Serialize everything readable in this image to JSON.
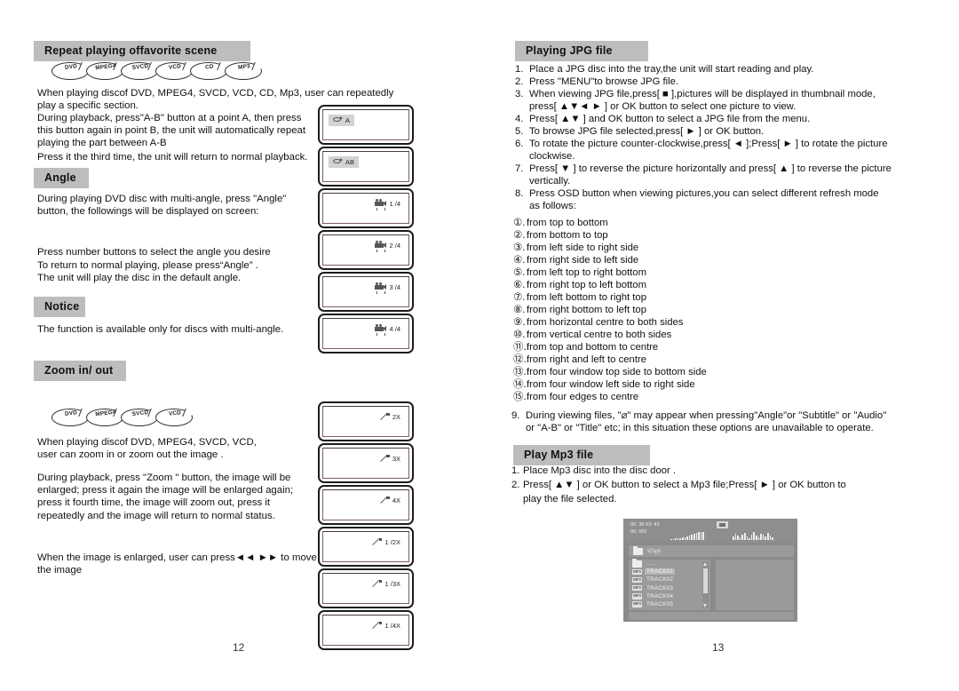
{
  "document": {
    "left_page_number": "12",
    "right_page_number": "13"
  },
  "left_column": {
    "sections": [
      {
        "title": "Repeat playing offavorite scene"
      },
      {
        "title": "Angle"
      },
      {
        "title": "Notice"
      },
      {
        "title": "Zoom in/ out"
      }
    ],
    "repeat": {
      "disc_formats": [
        "DVD",
        "MPEG4",
        "SVCD",
        "VCD",
        "CD",
        "MP3"
      ],
      "para1": "When playing discof DVD, MPEG4, SVCD, VCD, CD, Mp3,  user can repeatedly\nplay a specific section.",
      "para2": "During playback, press\"A-B\" button at a point A, then press\nthis button again in  point B, the unit will automatically repeat\nplaying the part between A-B",
      "para3": "Press it the third time, the unit will return to normal playback.",
      "screens": [
        {
          "icon": "repeat-icon",
          "label": "A"
        },
        {
          "icon": "repeat-icon",
          "label": "AB"
        }
      ]
    },
    "angle": {
      "para1": "During playing DVD disc with multi-angle, press \"Angle\"\n button, the followings will be displayed on screen:",
      "para2": "Press number buttons to select the angle you desire",
      "para3": "To return to normal playing, please press“Angle” .\nThe unit will play the disc in the default angle.",
      "screens": [
        {
          "icon": "camera-icon",
          "label": "1 /4"
        },
        {
          "icon": "camera-icon",
          "label": "2 /4"
        },
        {
          "icon": "camera-icon",
          "label": "3 /4"
        },
        {
          "icon": "camera-icon",
          "label": "4 /4"
        }
      ]
    },
    "notice": {
      "para1": "The function is available only for discs with multi-angle."
    },
    "zoom": {
      "disc_formats": [
        "DVD",
        "MPEG4",
        "SVCD",
        "VCD"
      ],
      "para1": "When playing discof DVD, MPEG4, SVCD, VCD,\nuser can zoom in or zoom out the image .",
      "para2": "During playback, press \"Zoom \" button, the image will be\nenlarged; press it again the image will be enlarged again;\npress it fourth time, the image will zoom out, press it\nrepeatedly and the image will return to normal status.",
      "para3": "When the image is enlarged, user can press◄◄ ►► to move\nthe image",
      "screens": [
        {
          "icon": "zoom-icon",
          "label": "2X"
        },
        {
          "icon": "zoom-icon",
          "label": "3X"
        },
        {
          "icon": "zoom-icon",
          "label": "4X"
        },
        {
          "icon": "zoom-icon",
          "label": "1 /2X"
        },
        {
          "icon": "zoom-icon",
          "label": "1 /3X"
        },
        {
          "icon": "zoom-icon",
          "label": "1 /4X"
        }
      ]
    }
  },
  "right_column": {
    "sections": [
      {
        "title": "Playing JPG file"
      },
      {
        "title": "Play Mp3 file"
      }
    ],
    "jpg_steps": [
      {
        "num": "1.",
        "text": "Place a JPG disc into the tray,the unit will start reading and play."
      },
      {
        "num": "2.",
        "text": "Press \"MENU\"to browse JPG file."
      },
      {
        "num": "3.",
        "text": "When viewing JPG file,press[ ■ ],pictures will be displayed in thumbnail mode,"
      },
      {
        "num": "",
        "text": "press[ ▲▼◄ ► ] or OK button to select one picture to view.",
        "indent": true
      },
      {
        "num": "4.",
        "text": "Press[ ▲▼ ] and OK button to select a JPG file from the menu."
      },
      {
        "num": "5.",
        "text": "To browse JPG file selected,press[ ► ]   or OK button."
      },
      {
        "num": "6.",
        "text": "To rotate the picture counter-clockwise,press[ ◄  ];Press[ ► ] to rotate the picture"
      },
      {
        "num": "",
        "text": "clockwise.",
        "indent": true
      },
      {
        "num": "7.",
        "text": "Press[ ▼ ]  to reverse the picture horizontally and press[ ▲ ]  to reverse the picture"
      },
      {
        "num": "",
        "text": "vertically.",
        "indent": true
      },
      {
        "num": "8.",
        "text": "Press OSD button when viewing pictures,you can select different refresh mode"
      },
      {
        "num": "",
        "text": "as follows:",
        "indent": true
      }
    ],
    "refresh_modes": [
      {
        "num": "①.",
        "text": "from top to bottom"
      },
      {
        "num": "②.",
        "text": "from bottom to top"
      },
      {
        "num": "③.",
        "text": "from left side to right side"
      },
      {
        "num": "④.",
        "text": "from right side to left side"
      },
      {
        "num": "⑤.",
        "text": "from left top to right bottom"
      },
      {
        "num": "⑥.",
        "text": "from right top to left bottom"
      },
      {
        "num": "⑦.",
        "text": "from left bottom to right top"
      },
      {
        "num": "⑧.",
        "text": "from right bottom to left top"
      },
      {
        "num": "⑨.",
        "text": "from horizontal centre to both sides"
      },
      {
        "num": "⑩.",
        "text": "from vertical centre to both sides"
      },
      {
        "num": "⑪.",
        "text": "from top and bottom to centre"
      },
      {
        "num": "⑫.",
        "text": "from right and left to centre"
      },
      {
        "num": "⑬.",
        "text": "from four window top side to bottom side"
      },
      {
        "num": "⑭.",
        "text": "from four window left side to right side"
      },
      {
        "num": "⑮.",
        "text": "from four edges to centre"
      }
    ],
    "jpg_note": [
      {
        "num": "9.",
        "text": "During viewing files, \"⌀\" may appear when pressing\"Angle\"or \"Subtitle\" or \"Audio\""
      },
      {
        "num": "",
        "text": "or \"A-B\" or \"Title\" etc; in this situation these options are unavailable to operate.",
        "indent": true
      }
    ],
    "mp3_steps": [
      {
        "num": "1.",
        "text": "Place Mp3 disc into the disc door ."
      },
      {
        "num": "2.",
        "text": "Press[ ▲▼ ]  or  OK button to select a Mp3 file;Press[ ► ]  or  OK  button to"
      },
      {
        "num": "",
        "text": "play the file selected.",
        "indent": true
      }
    ],
    "mp3_screen": {
      "time_display": "00: 36 03: 43\n00: 001",
      "path": "\\C\\yy\\",
      "up_entry": "......",
      "tracks": [
        {
          "badge": "MP3",
          "name": "TRACK01",
          "selected": true
        },
        {
          "badge": "MP3",
          "name": "TRACK02",
          "selected": false
        },
        {
          "badge": "MP3",
          "name": "TRACK03",
          "selected": false
        },
        {
          "badge": "MP3",
          "name": "TRACK04",
          "selected": false
        },
        {
          "badge": "MP3",
          "name": "TRACK05",
          "selected": false
        }
      ]
    }
  },
  "colors": {
    "section_bar": "#bdbdbd",
    "text": "#111111",
    "osd_tag": "#d3d3d3",
    "screen_bg": "#8a8a8a"
  }
}
